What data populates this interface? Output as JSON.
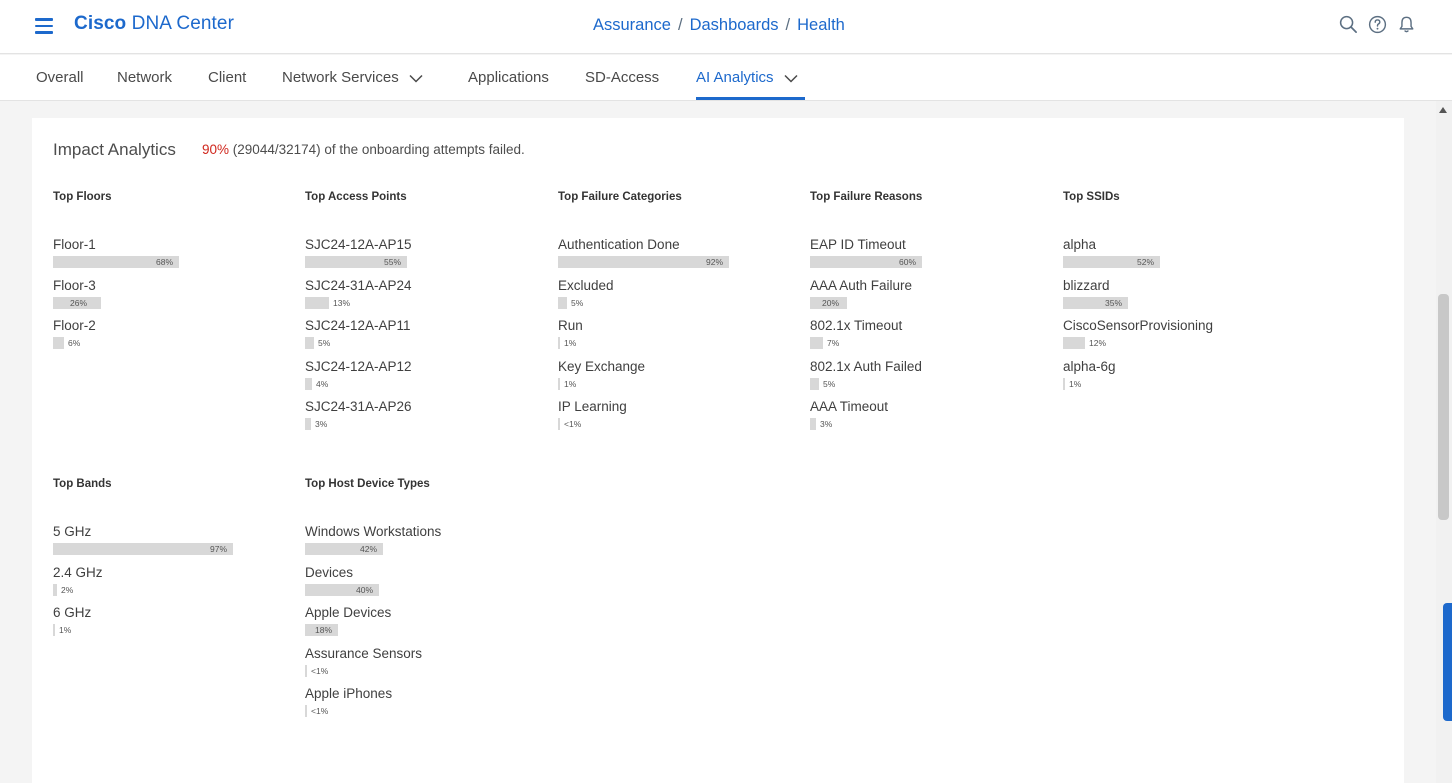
{
  "header": {
    "brand_bold": "Cisco",
    "brand_rest": "DNA Center",
    "breadcrumbs": [
      "Assurance",
      "Dashboards",
      "Health"
    ],
    "breadcrumb_sep": "/",
    "icons": [
      "search-icon",
      "help-icon",
      "bell-icon"
    ]
  },
  "tabs": [
    {
      "label": "Overall",
      "dropdown": false
    },
    {
      "label": "Network",
      "dropdown": false
    },
    {
      "label": "Client",
      "dropdown": false
    },
    {
      "label": "Network Services",
      "dropdown": true
    },
    {
      "label": "Applications",
      "dropdown": false
    },
    {
      "label": "SD-Access",
      "dropdown": false
    },
    {
      "label": "AI Analytics",
      "dropdown": true,
      "active": true
    }
  ],
  "panel": {
    "title": "Impact Analytics",
    "summary_pct": "90%",
    "summary_rest": "(29044/32174) of the onboarding attempts failed."
  },
  "colors": {
    "accent": "#1d69cc",
    "error": "#d0271d",
    "bar": "#d8d8d8"
  },
  "groups": [
    {
      "title": "Top Floors",
      "items": [
        {
          "label": "Floor-1",
          "pct": "68%",
          "value": 68
        },
        {
          "label": "Floor-3",
          "pct": "26%",
          "value": 26
        },
        {
          "label": "Floor-2",
          "pct": "6%",
          "value": 6
        }
      ]
    },
    {
      "title": "Top Access Points",
      "items": [
        {
          "label": "SJC24-12A-AP15",
          "pct": "55%",
          "value": 55
        },
        {
          "label": "SJC24-31A-AP24",
          "pct": "13%",
          "value": 13
        },
        {
          "label": "SJC24-12A-AP11",
          "pct": "5%",
          "value": 5
        },
        {
          "label": "SJC24-12A-AP12",
          "pct": "4%",
          "value": 4
        },
        {
          "label": "SJC24-31A-AP26",
          "pct": "3%",
          "value": 3
        }
      ]
    },
    {
      "title": "Top Failure Categories",
      "items": [
        {
          "label": "Authentication Done",
          "pct": "92%",
          "value": 92
        },
        {
          "label": "Excluded",
          "pct": "5%",
          "value": 5
        },
        {
          "label": "Run",
          "pct": "1%",
          "value": 1
        },
        {
          "label": "Key Exchange",
          "pct": "1%",
          "value": 1
        },
        {
          "label": "IP Learning",
          "pct": "<1%",
          "value": 0.5
        }
      ]
    },
    {
      "title": "Top Failure Reasons",
      "items": [
        {
          "label": "EAP ID Timeout",
          "pct": "60%",
          "value": 60
        },
        {
          "label": "AAA Auth Failure",
          "pct": "20%",
          "value": 20
        },
        {
          "label": "802.1x Timeout",
          "pct": "7%",
          "value": 7
        },
        {
          "label": "802.1x Auth Failed",
          "pct": "5%",
          "value": 5
        },
        {
          "label": "AAA Timeout",
          "pct": "3%",
          "value": 3
        }
      ]
    },
    {
      "title": "Top SSIDs",
      "items": [
        {
          "label": "alpha",
          "pct": "52%",
          "value": 52
        },
        {
          "label": "blizzard",
          "pct": "35%",
          "value": 35
        },
        {
          "label": "CiscoSensorProvisioning",
          "pct": "12%",
          "value": 12
        },
        {
          "label": "alpha-6g",
          "pct": "1%",
          "value": 1
        }
      ]
    },
    {
      "title": "Top Bands",
      "items": [
        {
          "label": "5 GHz",
          "pct": "97%",
          "value": 97
        },
        {
          "label": "2.4 GHz",
          "pct": "2%",
          "value": 2
        },
        {
          "label": "6 GHz",
          "pct": "1%",
          "value": 1
        }
      ]
    },
    {
      "title": "Top Host Device Types",
      "items": [
        {
          "label": "Windows Workstations",
          "pct": "42%",
          "value": 42
        },
        {
          "label": "Devices",
          "pct": "40%",
          "value": 40
        },
        {
          "label": "Apple Devices",
          "pct": "18%",
          "value": 18
        },
        {
          "label": "Assurance Sensors",
          "pct": "<1%",
          "value": 0.5
        },
        {
          "label": "Apple iPhones",
          "pct": "<1%",
          "value": 0.5
        }
      ]
    }
  ]
}
